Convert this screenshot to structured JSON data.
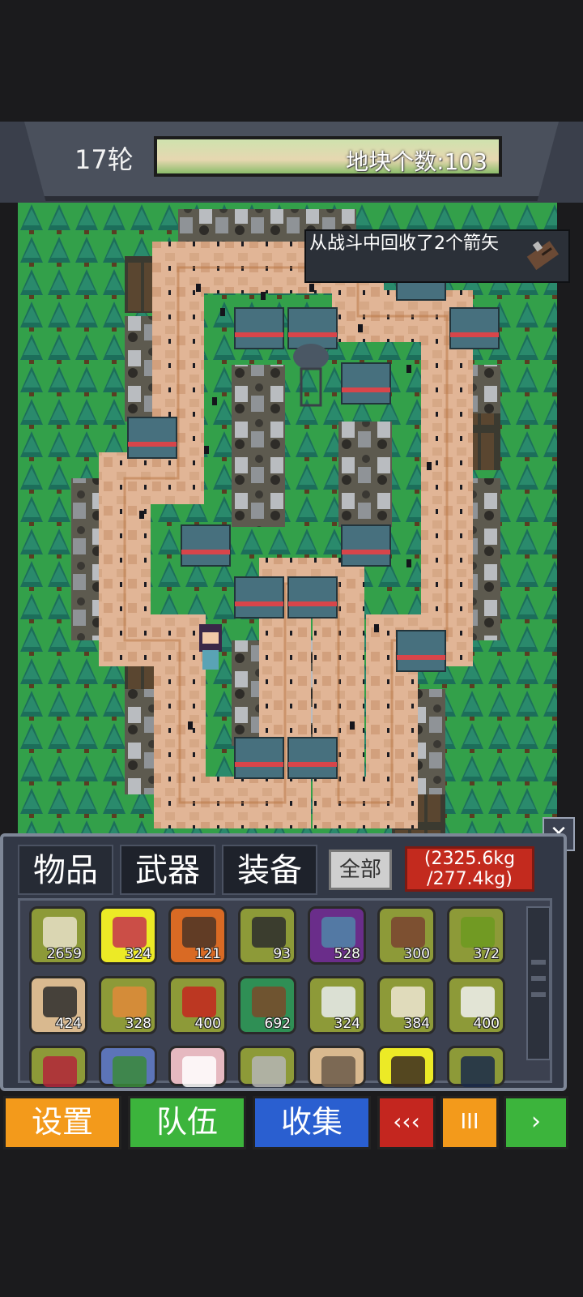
{
  "hud": {
    "round_label": "17轮",
    "tile_count_label": "地块个数:103"
  },
  "notice": {
    "message": "从战斗中回收了2个箭矢",
    "icon": "arrows-bundle-icon"
  },
  "inventory": {
    "tabs": [
      {
        "label": "物品",
        "active": true
      },
      {
        "label": "武器",
        "active": false
      },
      {
        "label": "装备",
        "active": false
      }
    ],
    "filter_label": "全部",
    "weight_current": "(2325.6kg",
    "weight_max": "/277.4kg)",
    "items": [
      {
        "icon": "supplies-icon",
        "count": "2659",
        "color": "olive"
      },
      {
        "icon": "potion-icon",
        "count": "324",
        "color": "yellow"
      },
      {
        "icon": "arrows-icon",
        "count": "121",
        "color": "orange"
      },
      {
        "icon": "bandage-roll-icon",
        "count": "93",
        "color": "olive"
      },
      {
        "icon": "shirt-icon",
        "count": "528",
        "color": "purple"
      },
      {
        "icon": "chocolate-icon",
        "count": "300",
        "color": "olive"
      },
      {
        "icon": "apple-icon",
        "count": "372",
        "color": "olive"
      },
      {
        "icon": "rope-icon",
        "count": "424",
        "color": "tan"
      },
      {
        "icon": "wooden-chair-icon",
        "count": "328",
        "color": "olive"
      },
      {
        "icon": "chili-pepper-icon",
        "count": "400",
        "color": "olive"
      },
      {
        "icon": "wood-log-icon",
        "count": "692",
        "color": "green"
      },
      {
        "icon": "cloth-icon",
        "count": "324",
        "color": "olive"
      },
      {
        "icon": "egg-icon",
        "count": "384",
        "color": "olive"
      },
      {
        "icon": "milk-bottle-icon",
        "count": "400",
        "color": "olive"
      },
      {
        "icon": "raw-meat-icon",
        "count": "",
        "color": "olive"
      },
      {
        "icon": "circuit-board-icon",
        "count": "",
        "color": "blue"
      },
      {
        "icon": "medkit-icon",
        "count": "",
        "color": "pink"
      },
      {
        "icon": "meat-can-icon",
        "count": "",
        "color": "olive"
      },
      {
        "icon": "canned-fish-icon",
        "count": "",
        "color": "tan"
      },
      {
        "icon": "bottle-icon",
        "count": "",
        "color": "yellow"
      },
      {
        "icon": "battery-icon",
        "count": "",
        "color": "olive"
      }
    ]
  },
  "buttons": {
    "settings": "设置",
    "team": "队伍",
    "collect": "收集",
    "rewind": "‹‹‹",
    "pause": "III",
    "play": "›"
  },
  "colors": {
    "settings": "#f39a1b",
    "team": "#3cb43c",
    "collect": "#2a5fd0",
    "rewind": "#c4261f",
    "pause": "#f39a1b",
    "play": "#3cb43c"
  }
}
